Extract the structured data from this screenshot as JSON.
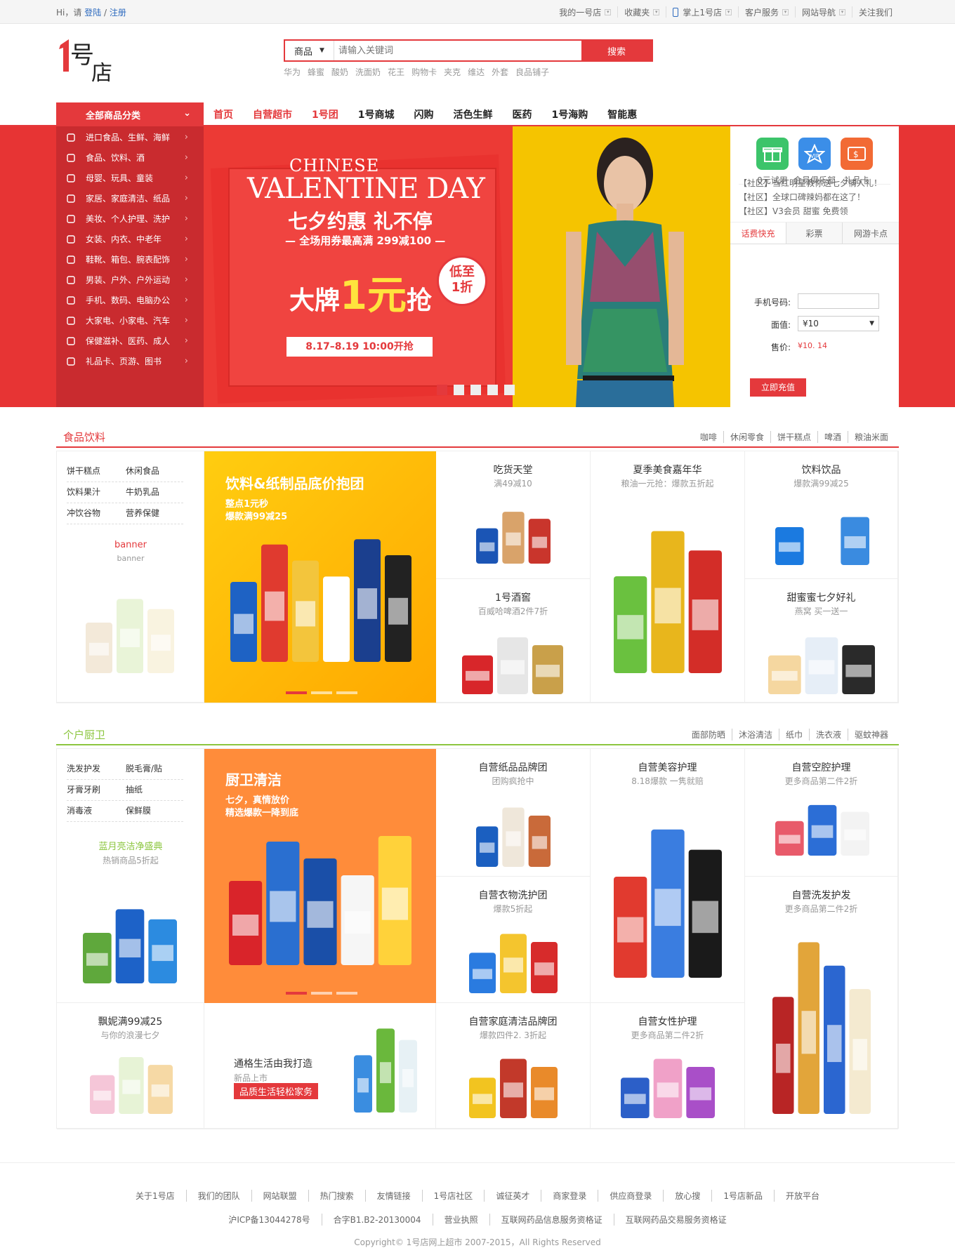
{
  "topbar": {
    "greeting": "Hi，请",
    "login": "登陆",
    "sep": "/",
    "register": "注册",
    "items": [
      "我的一号店",
      "收藏夹",
      "掌上1号店",
      "客户服务",
      "网站导航",
      "关注我们"
    ]
  },
  "search": {
    "category": "商品",
    "placeholder": "请输入关键词",
    "button": "搜索",
    "hotwords": [
      "华为",
      "蜂蜜",
      "酸奶",
      "洗面奶",
      "花王",
      "购物卡",
      "夹克",
      "维达",
      "外套",
      "良品铺子"
    ]
  },
  "nav": {
    "all_categories": "全部商品分类",
    "links": [
      "首页",
      "自营超市",
      "1号团",
      "1号商城",
      "闪购",
      "活色生鲜",
      "医药",
      "1号海购",
      "智能惠"
    ]
  },
  "sidebar": [
    "进口食品、生鲜、海鲜",
    "食品、饮料、酒",
    "母婴、玩具、童装",
    "家居、家庭清洁、纸品",
    "美妆、个人护理、洗护",
    "女装、内衣、中老年",
    "鞋靴、箱包、腕表配饰",
    "男装、户外、户外运动",
    "手机、数码、电脑办公",
    "大家电、小家电、汽车",
    "保健滋补、医药、成人",
    "礼品卡、页游、图书"
  ],
  "banner": {
    "line1": "CHINESE",
    "line2": "VALENTINE DAY",
    "line3": "七夕约惠 礼不停",
    "line4": "— 全场用券最高满 299减100 —",
    "badge1": "低至",
    "badge2": "1折",
    "big1": "大牌",
    "big2": "1元",
    "big3": "抢",
    "date": "8.17–8.19  10:00开抢"
  },
  "rightpanel": {
    "quick": [
      "0元试用",
      "会员俱乐部",
      "礼品卡"
    ],
    "news": [
      "【社区】当红明星教你送七夕情人礼！",
      "【社区】全球口碑辣妈都在这了！",
      "【社区】V3会员 甜蜜 免费领"
    ],
    "tabs": [
      "话费快充",
      "彩票",
      "网游卡点"
    ],
    "phone_label": "手机号码:",
    "value_label": "面值:",
    "value": "¥10",
    "price_label": "售价:",
    "price": "¥10. 14",
    "submit": "立即充值"
  },
  "food": {
    "title": "食品饮料",
    "tags": [
      "咖啡",
      "休闲零食",
      "饼干糕点",
      "啤酒",
      "粮油米面"
    ],
    "sublinks": [
      "饼干糕点",
      "休闲食品",
      "饮料果汁",
      "牛奶乳品",
      "冲饮谷物",
      "营养保健"
    ],
    "banner_title": "banner",
    "banner_sub": "banner",
    "promo_title": "饮料&纸制品底价抱团",
    "promo_sub1": "整点1元秒",
    "promo_sub2": "爆款满99减25",
    "cells": [
      {
        "t": "吃货天堂",
        "s": "满49减10"
      },
      {
        "t": "夏季美食嘉年华",
        "s": "粮油一元抢：爆款五折起"
      },
      {
        "t": "饮料饮品",
        "s": "爆款满99减25"
      },
      {
        "t": "1号酒窖",
        "s": "百威哈啤酒2件7折"
      },
      {
        "t": "甜蜜蜜七夕好礼",
        "s": "燕窝 买一送一"
      }
    ]
  },
  "home": {
    "title": "个户厨卫",
    "tags": [
      "面部防晒",
      "沐浴清洁",
      "纸巾",
      "洗衣液",
      "驱蚊神器"
    ],
    "sublinks": [
      "洗发护发",
      "脱毛膏/贴",
      "牙膏牙刷",
      "抽纸",
      "消毒液",
      "保鲜膜"
    ],
    "left_title": "蓝月亮洁净盛典",
    "left_sub": "热销商品5折起",
    "promo_title": "厨卫清洁",
    "promo_sub1": "七夕，真情放价",
    "promo_sub2": "精选爆款一降到底",
    "cells": [
      {
        "t": "自营纸品品牌团",
        "s": "团购疯抢中"
      },
      {
        "t": "自营美容护理",
        "s": "8.18爆款 一隽就赔"
      },
      {
        "t": "自营空腔护理",
        "s": "更多商品第二件2折"
      },
      {
        "t": "自营衣物洗护团",
        "s": "爆款5折起"
      },
      {
        "t": "自营洗发护发",
        "s": "更多商品第二件2折"
      },
      {
        "t": "飘妮满99减25",
        "s": "与你的浪漫七夕"
      },
      {
        "t": "自营家庭清洁品牌团",
        "s": "爆款四件2. 3折起"
      },
      {
        "t": "自营女性护理",
        "s": "更多商品第二件2折"
      }
    ],
    "life_title": "通格生活由我打造",
    "life_sub": "新品上市",
    "life_tag": "品质生活轻松家务"
  },
  "footer": {
    "links": [
      "关于1号店",
      "我们的团队",
      "网站联盟",
      "热门搜索",
      "友情链接",
      "1号店社区",
      "诚征英才",
      "商家登录",
      "供应商登录",
      "放心搜",
      "1号店新品",
      "开放平台"
    ],
    "licenses": [
      "沪ICP备13044278号",
      "合字B1.B2-20130004",
      "营业执照",
      "互联网药品信息服务资格证",
      "互联网药品交易服务资格证"
    ],
    "copyright": "Copyright© 1号店网上超市 2007-2015，All Rights Reserved"
  },
  "colors": {
    "brand": "#e4393c",
    "green": "#8cc63f"
  }
}
